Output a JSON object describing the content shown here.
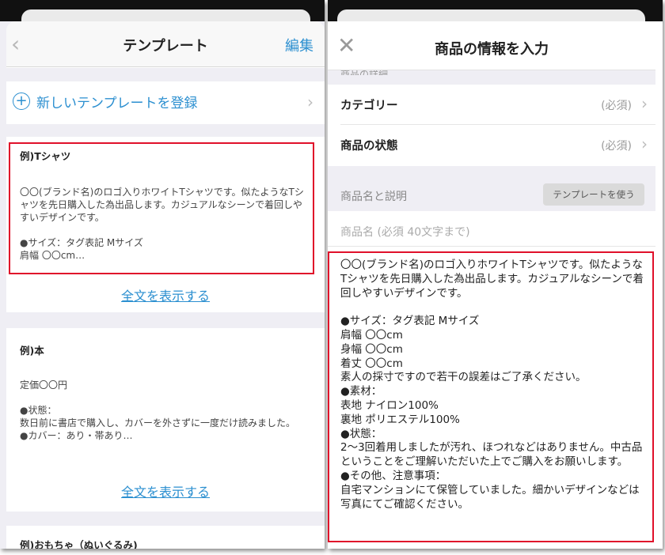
{
  "left": {
    "nav": {
      "title": "テンプレート",
      "edit": "編集"
    },
    "add_template": "新しいテンプレートを登録",
    "cards": [
      {
        "title": "例)Tシャツ",
        "body": "〇〇(ブランド名)のロゴ入りホワイトTシャツです。似たようなTシャツを先日購入した為出品します。カジュアルなシーンで着回しやすいデザインです。\n\n●サイズ：タグ表記 Mサイズ\n肩幅 〇〇cm…"
      },
      {
        "title": "例)本",
        "body": "定価〇〇円\n\n●状態：\n数日前に書店で購入し、カバーを外さずに一度だけ読みました。\n●カバー：あり・帯あり…"
      },
      {
        "title": "例)おもちゃ（ぬいぐるみ)"
      }
    ],
    "show_more": "全文を表示する"
  },
  "right": {
    "nav": {
      "title": "商品の情報を入力"
    },
    "cut_label": "商品の詳細",
    "rows": [
      {
        "label": "カテゴリー",
        "value": "(必須)"
      },
      {
        "label": "商品の状態",
        "value": "(必須)"
      }
    ],
    "section_label": "商品名と説明",
    "template_button": "テンプレートを使う",
    "name_placeholder": "商品名 (必須 40文字まで)",
    "description": "〇〇(ブランド名)のロゴ入りホワイトTシャツです。似たようなTシャツを先日購入した為出品します。カジュアルなシーンで着回しやすいデザインです。\n\n●サイズ：タグ表記 Mサイズ\n肩幅 〇〇cm\n身幅 〇〇cm\n着丈 〇〇cm\n素人の採寸ですので若干の誤差はご了承ください。\n●素材：\n表地 ナイロン100%\n裏地 ポリエステル100%\n●状態：\n2〜3回着用しましたが汚れ、ほつれなどはありません。中古品ということをご理解いただいた上でご購入をお願いします。\n●その他、注意事項：\n自宅マンションにて保管していました。細かいデザインなどは写真にてご確認ください。"
  },
  "colors": {
    "accent": "#2b8fd0",
    "highlight": "#e0102a",
    "background": "#efeef4"
  }
}
